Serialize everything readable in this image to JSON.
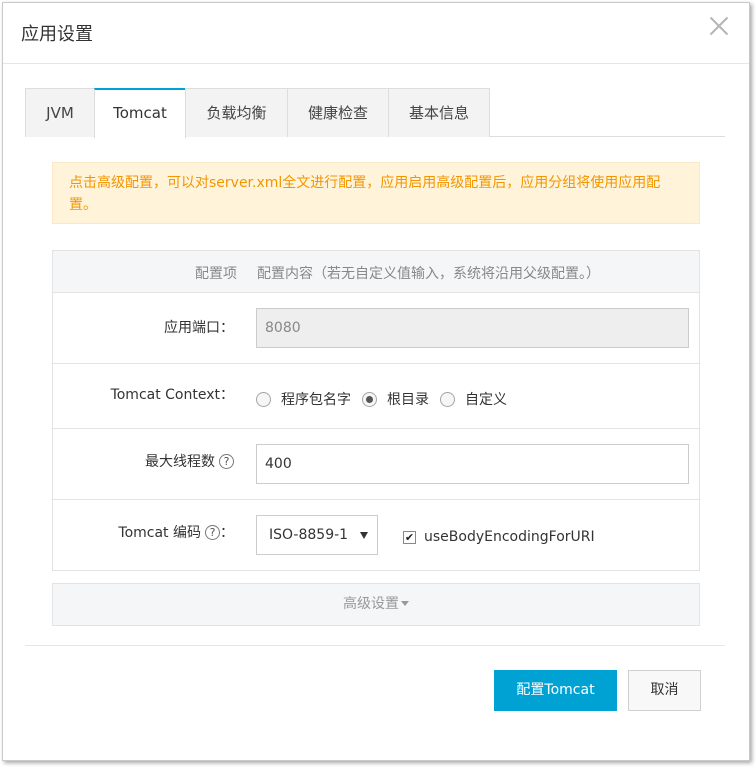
{
  "dialog": {
    "title": "应用设置"
  },
  "tabs": [
    {
      "label": "JVM",
      "active": false
    },
    {
      "label": "Tomcat",
      "active": true
    },
    {
      "label": "负载均衡",
      "active": false
    },
    {
      "label": "健康检查",
      "active": false
    },
    {
      "label": "基本信息",
      "active": false
    }
  ],
  "alert": {
    "text": "点击高级配置，可以对server.xml全文进行配置，应用启用高级配置后，应用分组将使用应用配置。"
  },
  "table": {
    "header_key": "配置项",
    "header_value": "配置内容（若无自定义值输入，系统将沿用父级配置。）",
    "port": {
      "label": "应用端口：",
      "value": "8080"
    },
    "context": {
      "label": "Tomcat Context：",
      "options": [
        "程序包名字",
        "根目录",
        "自定义"
      ],
      "selected": "根目录"
    },
    "max_threads": {
      "label": "最大线程数",
      "value": "400"
    },
    "encoding": {
      "label": "Tomcat 编码",
      "label_suffix": "：",
      "selected": "ISO-8859-1",
      "checkbox_label": "useBodyEncodingForURI",
      "checkbox_checked": true
    }
  },
  "advanced": {
    "label": "高级设置"
  },
  "footer": {
    "confirm_label": "配置Tomcat",
    "cancel_label": "取消"
  },
  "icons": {
    "help": "?",
    "check": "✔"
  },
  "colors": {
    "primary": "#00a2d4",
    "warning_text": "#f29600",
    "warning_bg": "#fff3da"
  }
}
